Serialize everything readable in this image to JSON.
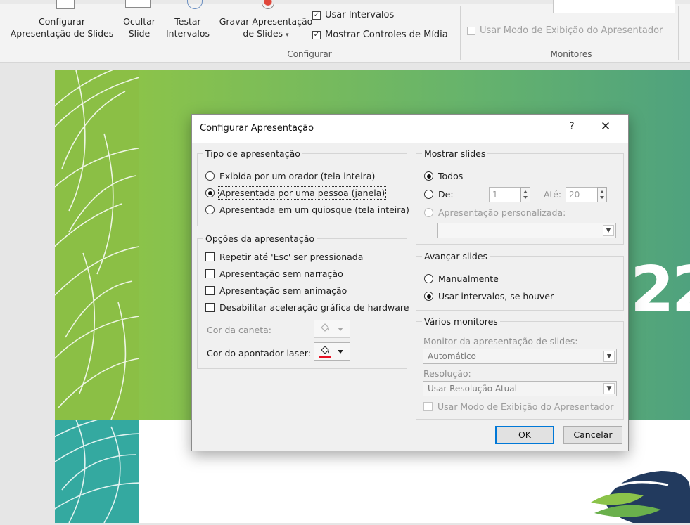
{
  "ribbon": {
    "configure_show_line1": "Configurar",
    "configure_show_line2": "Apresentação de Slides",
    "hide_slide_line1": "Ocultar",
    "hide_slide_line2": "Slide",
    "rehearse_line1": "Testar",
    "rehearse_line2": "Intervalos",
    "record_line1": "Gravar Apresentação",
    "record_line2": "de Slides",
    "use_timings": "Usar Intervalos",
    "show_media_controls": "Mostrar Controles de Mídia",
    "group_configure": "Configurar",
    "presenter_view": "Usar Modo de Exibição do Apresentador",
    "group_monitors": "Monitores"
  },
  "slide": {
    "big_text": "22"
  },
  "dialog": {
    "title": "Configurar Apresentação",
    "help": "?",
    "close": "✕",
    "show_type": {
      "legend": "Tipo de apresentação",
      "opt1": "Exibida por um orador (tela inteira)",
      "opt2": "Apresentada por uma pessoa (janela)",
      "opt3": "Apresentada em um quiosque (tela inteira)",
      "selected": 2
    },
    "show_options": {
      "legend": "Opções da apresentação",
      "loop": "Repetir até 'Esc' ser pressionada",
      "no_narration": "Apresentação sem narração",
      "no_animation": "Apresentação sem animação",
      "no_hw_accel": "Desabilitar aceleração gráfica de hardware",
      "pen_color": "Cor da caneta:",
      "laser_color": "Cor do apontador laser:",
      "laser_color_value": "#e81123"
    },
    "show_slides": {
      "legend": "Mostrar slides",
      "all": "Todos",
      "from": "De:",
      "from_value": "1",
      "to": "Até:",
      "to_value": "20",
      "custom": "Apresentação personalizada:"
    },
    "advance": {
      "legend": "Avançar slides",
      "manual": "Manualmente",
      "timings": "Usar intervalos, se houver"
    },
    "monitors": {
      "legend": "Vários monitores",
      "monitor_label": "Monitor da apresentação de slides:",
      "monitor_value": "Automático",
      "resolution_label": "Resolução:",
      "resolution_value": "Usar Resolução Atual",
      "presenter_view": "Usar Modo de Exibição do Apresentador"
    },
    "ok": "OK",
    "cancel": "Cancelar"
  }
}
